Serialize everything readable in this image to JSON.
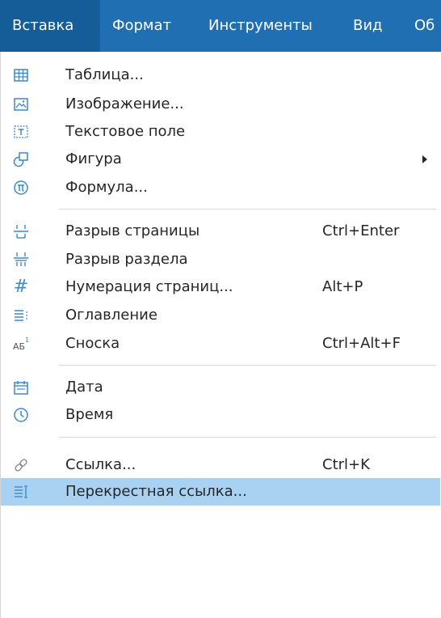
{
  "menubar": {
    "items": [
      {
        "label": "Вставка",
        "active": true
      },
      {
        "label": "Формат"
      },
      {
        "label": "Инструменты"
      },
      {
        "label": "Вид"
      },
      {
        "label": "Об"
      }
    ]
  },
  "menu": {
    "items": [
      {
        "icon": "table-icon",
        "label": "Таблица..."
      },
      {
        "icon": "image-icon",
        "label": "Изображение..."
      },
      {
        "icon": "text-field-icon",
        "label": "Текстовое поле"
      },
      {
        "icon": "shape-icon",
        "label": "Фигура",
        "submenu": true
      },
      {
        "icon": "formula-icon",
        "label": "Формула..."
      },
      {
        "icon": "page-break-icon",
        "label": "Разрыв страницы",
        "shortcut": "Ctrl+Enter"
      },
      {
        "icon": "section-break-icon",
        "label": "Разрыв раздела"
      },
      {
        "icon": "page-numbering-icon",
        "label": "Нумерация страниц...",
        "shortcut": "Alt+P"
      },
      {
        "icon": "table-of-contents-icon",
        "label": "Оглавление"
      },
      {
        "icon": "footnote-icon",
        "label": "Сноска",
        "shortcut": "Ctrl+Alt+F"
      },
      {
        "icon": "date-icon",
        "label": "Дата"
      },
      {
        "icon": "time-icon",
        "label": "Время"
      },
      {
        "icon": "link-icon",
        "label": "Ссылка...",
        "shortcut": "Ctrl+K"
      },
      {
        "icon": "cross-reference-icon",
        "label": "Перекрестная ссылка...",
        "highlighted": true
      }
    ]
  },
  "colors": {
    "menubar_bg": "#1f6fb2",
    "highlight_bg": "#a9d1f1",
    "icon_color": "#3d89c9"
  }
}
